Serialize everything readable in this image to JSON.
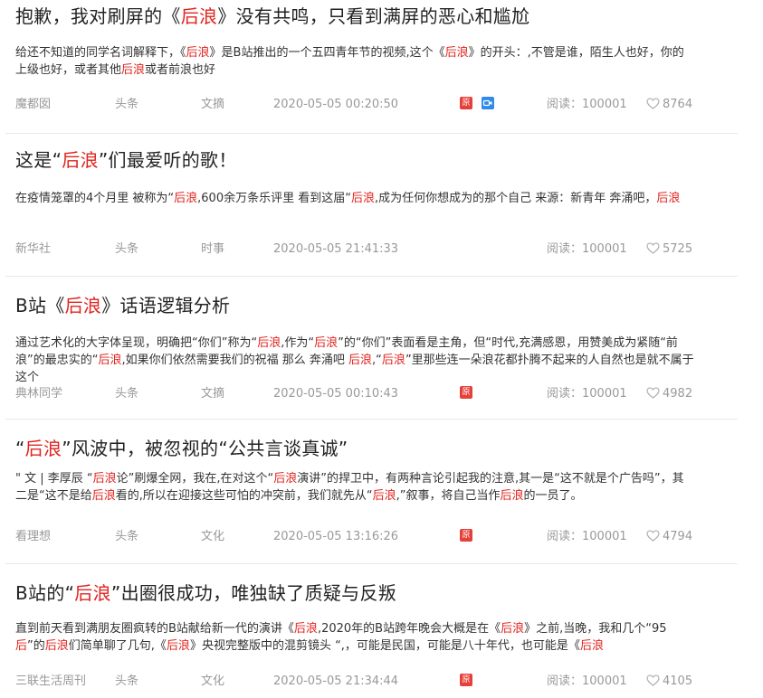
{
  "articles": [
    {
      "title": [
        {
          "t": "抱歉，我对刷屏的《"
        },
        {
          "t": "后浪",
          "hl": true
        },
        {
          "t": "》没有共鸣，只看到满屏的恶心和尴尬"
        }
      ],
      "summary": [
        {
          "t": "给还不知道的同学名词解释下，《"
        },
        {
          "t": "后浪",
          "hl": true
        },
        {
          "t": "》是B站推出的一个五四青年节的视频,这个《"
        },
        {
          "t": "后浪",
          "hl": true
        },
        {
          "t": "》的开头：,不管是谁，陌生人也好，你的上级也好，或者其他"
        },
        {
          "t": "后浪",
          "hl": true
        },
        {
          "t": "或者前浪也好"
        }
      ],
      "source": "魔都囡",
      "channel": "头条",
      "category": "文摘",
      "time": "2020-05-05 00:20:50",
      "badges": [
        "original",
        "video"
      ],
      "reads_label": "阅读：",
      "reads": "100001",
      "likes": "8764"
    },
    {
      "title": [
        {
          "t": "这是“"
        },
        {
          "t": "后浪",
          "hl": true
        },
        {
          "t": "”们最爱听的歌！"
        }
      ],
      "summary": [
        {
          "t": "在疫情笼罩的4个月里 被称为“"
        },
        {
          "t": "后浪",
          "hl": true
        },
        {
          "t": ",600余万条乐评里 看到这届“"
        },
        {
          "t": "后浪",
          "hl": true
        },
        {
          "t": ",成为任何你想成为的那个自己 来源：新青年 奔涌吧，"
        },
        {
          "t": "后浪",
          "hl": true
        }
      ],
      "source": "新华社",
      "channel": "头条",
      "category": "时事",
      "time": "2020-05-05 21:41:33",
      "badges": [],
      "reads_label": "阅读：",
      "reads": "100001",
      "likes": "5725"
    },
    {
      "title": [
        {
          "t": "B站《"
        },
        {
          "t": "后浪",
          "hl": true
        },
        {
          "t": "》话语逻辑分析"
        }
      ],
      "summary": [
        {
          "t": "通过艺术化的大字体呈现，明确把“你们”称为“"
        },
        {
          "t": "后浪",
          "hl": true
        },
        {
          "t": ",作为“"
        },
        {
          "t": "后浪",
          "hl": true
        },
        {
          "t": "”的“你们”表面看是主角，但“时代,充满感恩，用赞美成为紧随“前浪”的最忠实的“"
        },
        {
          "t": "后浪",
          "hl": true
        },
        {
          "t": ",如果你们依然需要我们的祝福 那么 奔涌吧 "
        },
        {
          "t": "后浪",
          "hl": true
        },
        {
          "t": ",“"
        },
        {
          "t": "后浪",
          "hl": true
        },
        {
          "t": "”里那些连一朵浪花都扑腾不起来的人自然也是就不属于这个"
        }
      ],
      "source": "典林同学",
      "channel": "头条",
      "category": "文摘",
      "time": "2020-05-05 00:10:43",
      "badges": [
        "original"
      ],
      "reads_label": "阅读：",
      "reads": "100001",
      "likes": "4982"
    },
    {
      "title": [
        {
          "t": "“"
        },
        {
          "t": "后浪",
          "hl": true
        },
        {
          "t": "”风波中，被忽视的“公共言谈真诚”"
        }
      ],
      "summary": [
        {
          "t": "\" 文 | 李厚辰 “"
        },
        {
          "t": "后浪",
          "hl": true
        },
        {
          "t": "论”刷爆全网，我在,在对这个“"
        },
        {
          "t": "后浪",
          "hl": true
        },
        {
          "t": "演讲”的捍卫中，有两种言论引起我的注意,其一是“这不就是个广告吗”，其二是“这不是给"
        },
        {
          "t": "后浪",
          "hl": true
        },
        {
          "t": "看的,所以在迎接这些可怕的冲突前，我们就先从“"
        },
        {
          "t": "后浪",
          "hl": true
        },
        {
          "t": ",”叙事，将自己当作"
        },
        {
          "t": "后浪",
          "hl": true
        },
        {
          "t": "的一员了。"
        }
      ],
      "source": "看理想",
      "channel": "头条",
      "category": "文化",
      "time": "2020-05-05 13:16:26",
      "badges": [
        "original"
      ],
      "reads_label": "阅读：",
      "reads": "100001",
      "likes": "4794"
    },
    {
      "title": [
        {
          "t": "B站的“"
        },
        {
          "t": "后浪",
          "hl": true
        },
        {
          "t": "”出圈很成功，唯独缺了质疑与反叛"
        }
      ],
      "summary": [
        {
          "t": "直到前天看到满朋友圈疯转的B站献给新一代的演讲《"
        },
        {
          "t": "后浪",
          "hl": true
        },
        {
          "t": ",2020年的B站跨年晚会大概是在《"
        },
        {
          "t": "后浪",
          "hl": true
        },
        {
          "t": "》之前,当晚，我和几个“95"
        },
        {
          "t": "后",
          "hl": true
        },
        {
          "t": "”的"
        },
        {
          "t": "后浪",
          "hl": true
        },
        {
          "t": "们简单聊了几句,《"
        },
        {
          "t": "后浪",
          "hl": true
        },
        {
          "t": "》央视完整版中的混剪镜头 “,，可能是民国，可能是八十年代，也可能是《"
        },
        {
          "t": "后浪",
          "hl": true
        }
      ],
      "source": "三联生活周刊",
      "channel": "头条",
      "category": "文化",
      "time": "2020-05-05 21:34:44",
      "badges": [
        "original"
      ],
      "reads_label": "阅读：",
      "reads": "100001",
      "likes": "4105"
    }
  ],
  "badge_labels": {
    "original": "原",
    "video": ""
  },
  "colors": {
    "highlight": "#e0241f",
    "meta": "#999999",
    "badge_original": "#e6403a",
    "badge_video": "#2f8ae8",
    "divider": "#e8e8e8"
  },
  "icons": {
    "likes": "heart-outline-icon",
    "video": "video-camera-icon"
  }
}
